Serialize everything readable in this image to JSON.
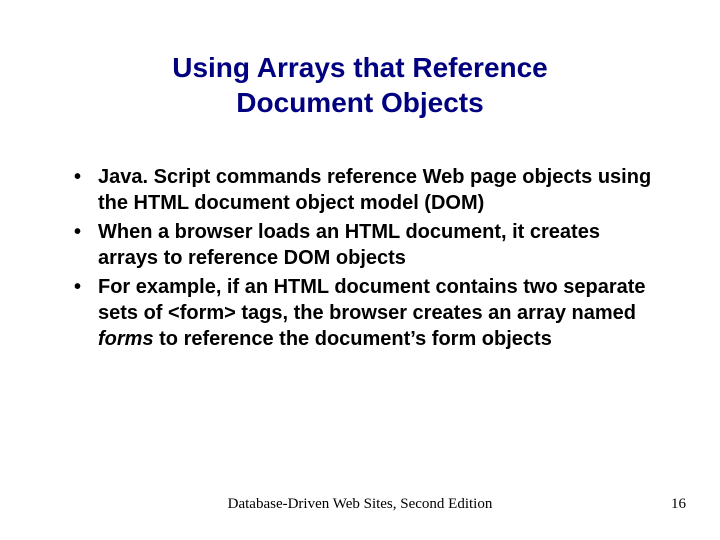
{
  "title_line1": "Using Arrays that Reference",
  "title_line2": "Document Objects",
  "bullets": {
    "b1": "Java. Script commands reference Web page objects using the HTML document object model (DOM)",
    "b2": "When a browser loads an HTML document, it creates arrays to reference DOM objects",
    "b3_a": "For example, if an HTML document contains two separate sets of <form> tags, the browser creates an array named ",
    "b3_b": "forms",
    "b3_c": " to reference the document’s form objects"
  },
  "footer": {
    "center": "Database-Driven Web Sites, Second Edition",
    "page": "16"
  }
}
